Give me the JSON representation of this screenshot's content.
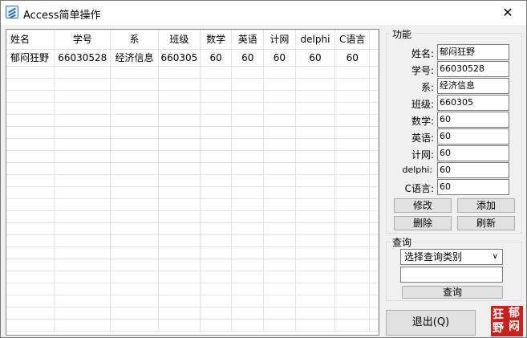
{
  "window": {
    "title": "Access简单操作",
    "close_glyph": "✕"
  },
  "grid": {
    "columns": [
      "姓名",
      "学号",
      "系",
      "班级",
      "数学",
      "英语",
      "计网",
      "delphi",
      "C语言"
    ],
    "rows": [
      [
        "郁闷狂野",
        "66030528",
        "经济信息",
        "660305",
        "60",
        "60",
        "60",
        "60",
        "60"
      ]
    ]
  },
  "form": {
    "group_label": "功能",
    "fields": [
      {
        "label": "姓名:",
        "value": "郁闷狂野"
      },
      {
        "label": "学号:",
        "value": "66030528"
      },
      {
        "label": "系:",
        "value": "经济信息"
      },
      {
        "label": "班级:",
        "value": "660305"
      },
      {
        "label": "数学:",
        "value": "60"
      },
      {
        "label": "英语:",
        "value": "60"
      },
      {
        "label": "计网:",
        "value": "60"
      },
      {
        "label": "delphi:",
        "value": "60"
      },
      {
        "label": "C语言:",
        "value": "60"
      }
    ],
    "buttons": {
      "modify": "修改",
      "add": "添加",
      "delete": "删除",
      "refresh": "刷新"
    }
  },
  "query": {
    "group_label": "查询",
    "select_value": "选择查询类别",
    "input_value": "",
    "button": "查询"
  },
  "exit_button": "退出(Q)",
  "stamp": {
    "glyphs": [
      "狂",
      "郁",
      "野",
      "闷"
    ]
  }
}
